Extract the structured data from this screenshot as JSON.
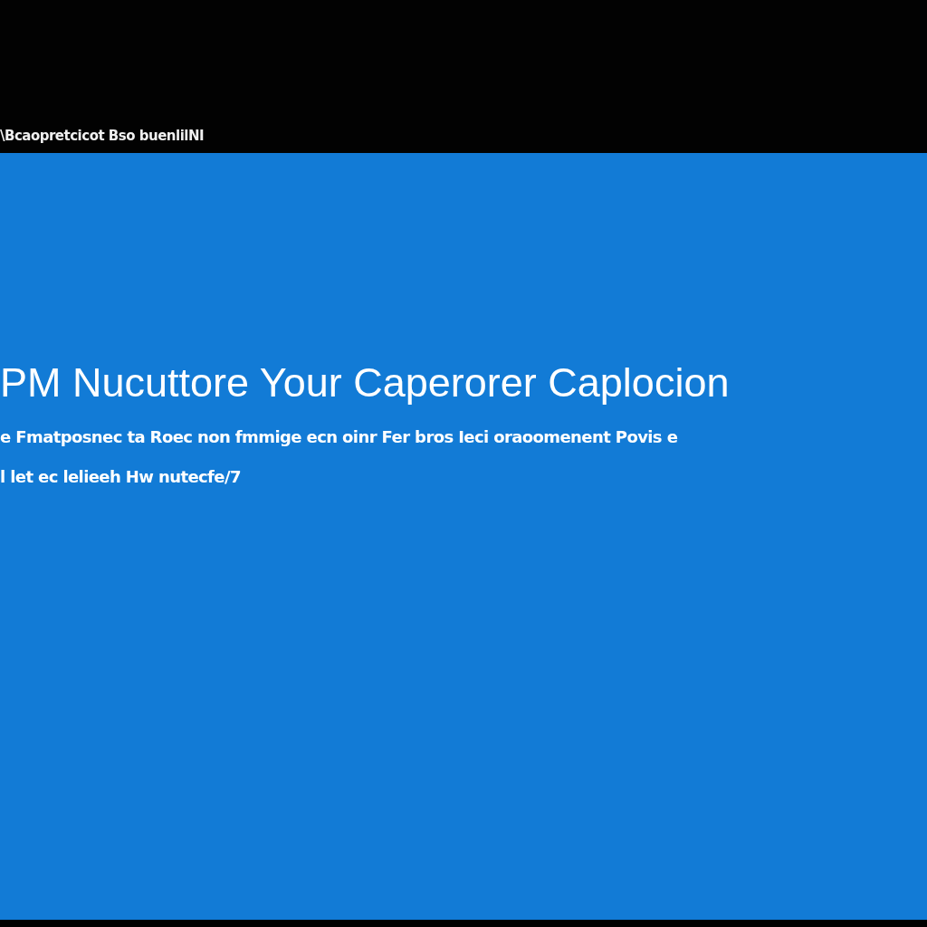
{
  "top_bar": {
    "text": "\\Bcaopretcicot Bso buenlilNI"
  },
  "screen": {
    "title": "PM Nucuttore Your Caperorer Caplocion",
    "message": [
      "e Fmatposnec ta Roec non fmmige ecn oinr Fer bros Ieci oraoomenent Povis e",
      "l let ec lelieeh Hw nutecfe/7"
    ]
  }
}
